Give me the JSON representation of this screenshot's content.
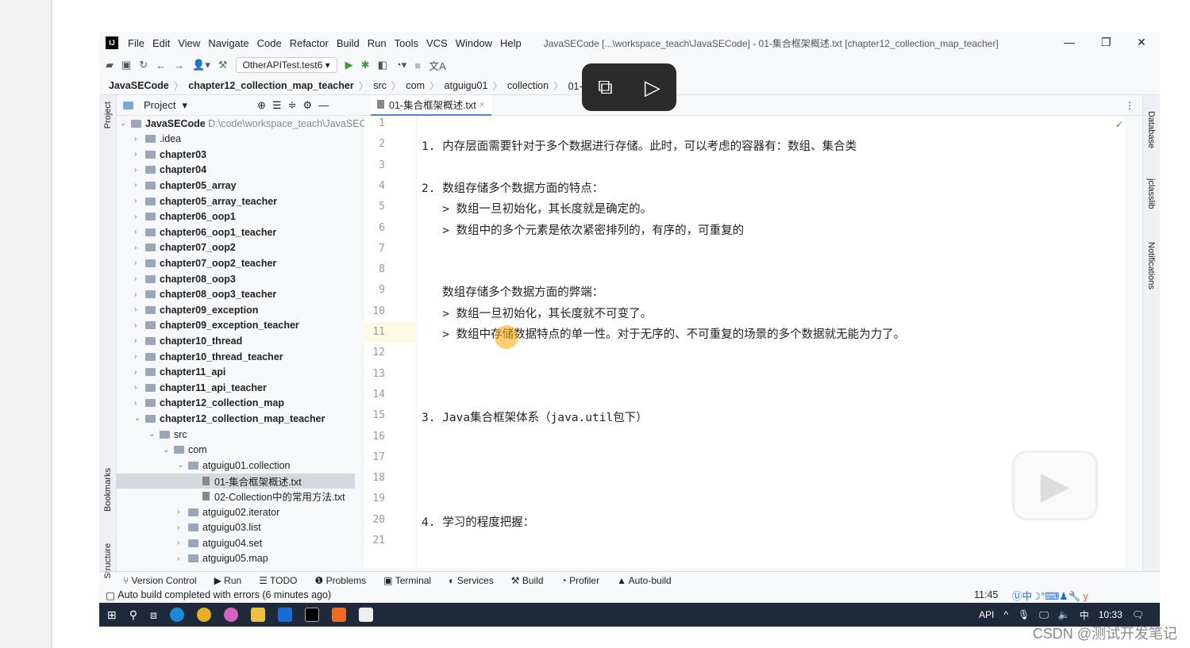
{
  "menubar": {
    "items": [
      "File",
      "Edit",
      "View",
      "Navigate",
      "Code",
      "Refactor",
      "Build",
      "Run",
      "Tools",
      "VCS",
      "Window",
      "Help"
    ],
    "title": "JavaSECode [...\\workspace_teach\\JavaSECode] - 01-集合框架概述.txt [chapter12_collection_map_teacher]"
  },
  "toolbar": {
    "run_config": "OtherAPITest.test6"
  },
  "breadcrumb": [
    "JavaSECode",
    "chapter12_collection_map_teacher",
    "src",
    "com",
    "atguigu01",
    "collection",
    "01-集合框架"
  ],
  "project": {
    "label": "Project",
    "root": "JavaSECode",
    "root_path": "D:\\code\\workspace_teach\\JavaSEC",
    "items": [
      {
        "label": ".idea",
        "depth": 1,
        "bold": false
      },
      {
        "label": "chapter03",
        "depth": 1,
        "bold": true
      },
      {
        "label": "chapter04",
        "depth": 1,
        "bold": true
      },
      {
        "label": "chapter05_array",
        "depth": 1,
        "bold": true
      },
      {
        "label": "chapter05_array_teacher",
        "depth": 1,
        "bold": true
      },
      {
        "label": "chapter06_oop1",
        "depth": 1,
        "bold": true
      },
      {
        "label": "chapter06_oop1_teacher",
        "depth": 1,
        "bold": true
      },
      {
        "label": "chapter07_oop2",
        "depth": 1,
        "bold": true
      },
      {
        "label": "chapter07_oop2_teacher",
        "depth": 1,
        "bold": true
      },
      {
        "label": "chapter08_oop3",
        "depth": 1,
        "bold": true
      },
      {
        "label": "chapter08_oop3_teacher",
        "depth": 1,
        "bold": true
      },
      {
        "label": "chapter09_exception",
        "depth": 1,
        "bold": true
      },
      {
        "label": "chapter09_exception_teacher",
        "depth": 1,
        "bold": true
      },
      {
        "label": "chapter10_thread",
        "depth": 1,
        "bold": true
      },
      {
        "label": "chapter10_thread_teacher",
        "depth": 1,
        "bold": true
      },
      {
        "label": "chapter11_api",
        "depth": 1,
        "bold": true
      },
      {
        "label": "chapter11_api_teacher",
        "depth": 1,
        "bold": true
      },
      {
        "label": "chapter12_collection_map",
        "depth": 1,
        "bold": true
      },
      {
        "label": "chapter12_collection_map_teacher",
        "depth": 1,
        "bold": true,
        "open": true
      },
      {
        "label": "src",
        "depth": 2,
        "open": true
      },
      {
        "label": "com",
        "depth": 3,
        "open": true
      },
      {
        "label": "atguigu01.collection",
        "depth": 4,
        "open": true
      },
      {
        "label": "01-集合框架概述.txt",
        "depth": 5,
        "file": true,
        "selected": true
      },
      {
        "label": "02-Collection中的常用方法.txt",
        "depth": 5,
        "file": true
      },
      {
        "label": "atguigu02.iterator",
        "depth": 4
      },
      {
        "label": "atguigu03.list",
        "depth": 4
      },
      {
        "label": "atguigu04.set",
        "depth": 4
      },
      {
        "label": "atguigu05.map",
        "depth": 4
      }
    ]
  },
  "editor": {
    "tab": "01-集合框架概述.txt",
    "current_line": 11,
    "lines": [
      "",
      "1. 内存层面需要针对于多个数据进行存储。此时，可以考虑的容器有：数组、集合类",
      "",
      "2. 数组存储多个数据方面的特点：",
      "   > 数组一旦初始化，其长度就是确定的。",
      "   > 数组中的多个元素是依次紧密排列的，有序的，可重复的",
      "",
      "",
      "   数组存储多个数据方面的弊端：",
      "   > 数组一旦初始化，其长度就不可变了。",
      "   > 数组中存储数据特点的单一性。对于无序的、不可重复的场景的多个数据就无能为力了。",
      "",
      "",
      "",
      "3. Java集合框架体系（java.util包下）",
      "",
      "",
      "",
      "",
      "4. 学习的程度把握：",
      ""
    ]
  },
  "side_left": [
    "Project",
    "Bookmarks",
    "Structure"
  ],
  "side_right": [
    "Database",
    "jclasslib",
    "Notifications"
  ],
  "toolwindows": [
    "Version Control",
    "Run",
    "TODO",
    "Problems",
    "Terminal",
    "Services",
    "Build",
    "Profiler",
    "Auto-build"
  ],
  "status": {
    "message": "Auto build completed with errors (6 minutes ago)",
    "position": "11:45"
  },
  "taskbar": {
    "api": "API",
    "ime": "中",
    "time": "10:33"
  },
  "watermark": "CSDN @测试开发笔记"
}
